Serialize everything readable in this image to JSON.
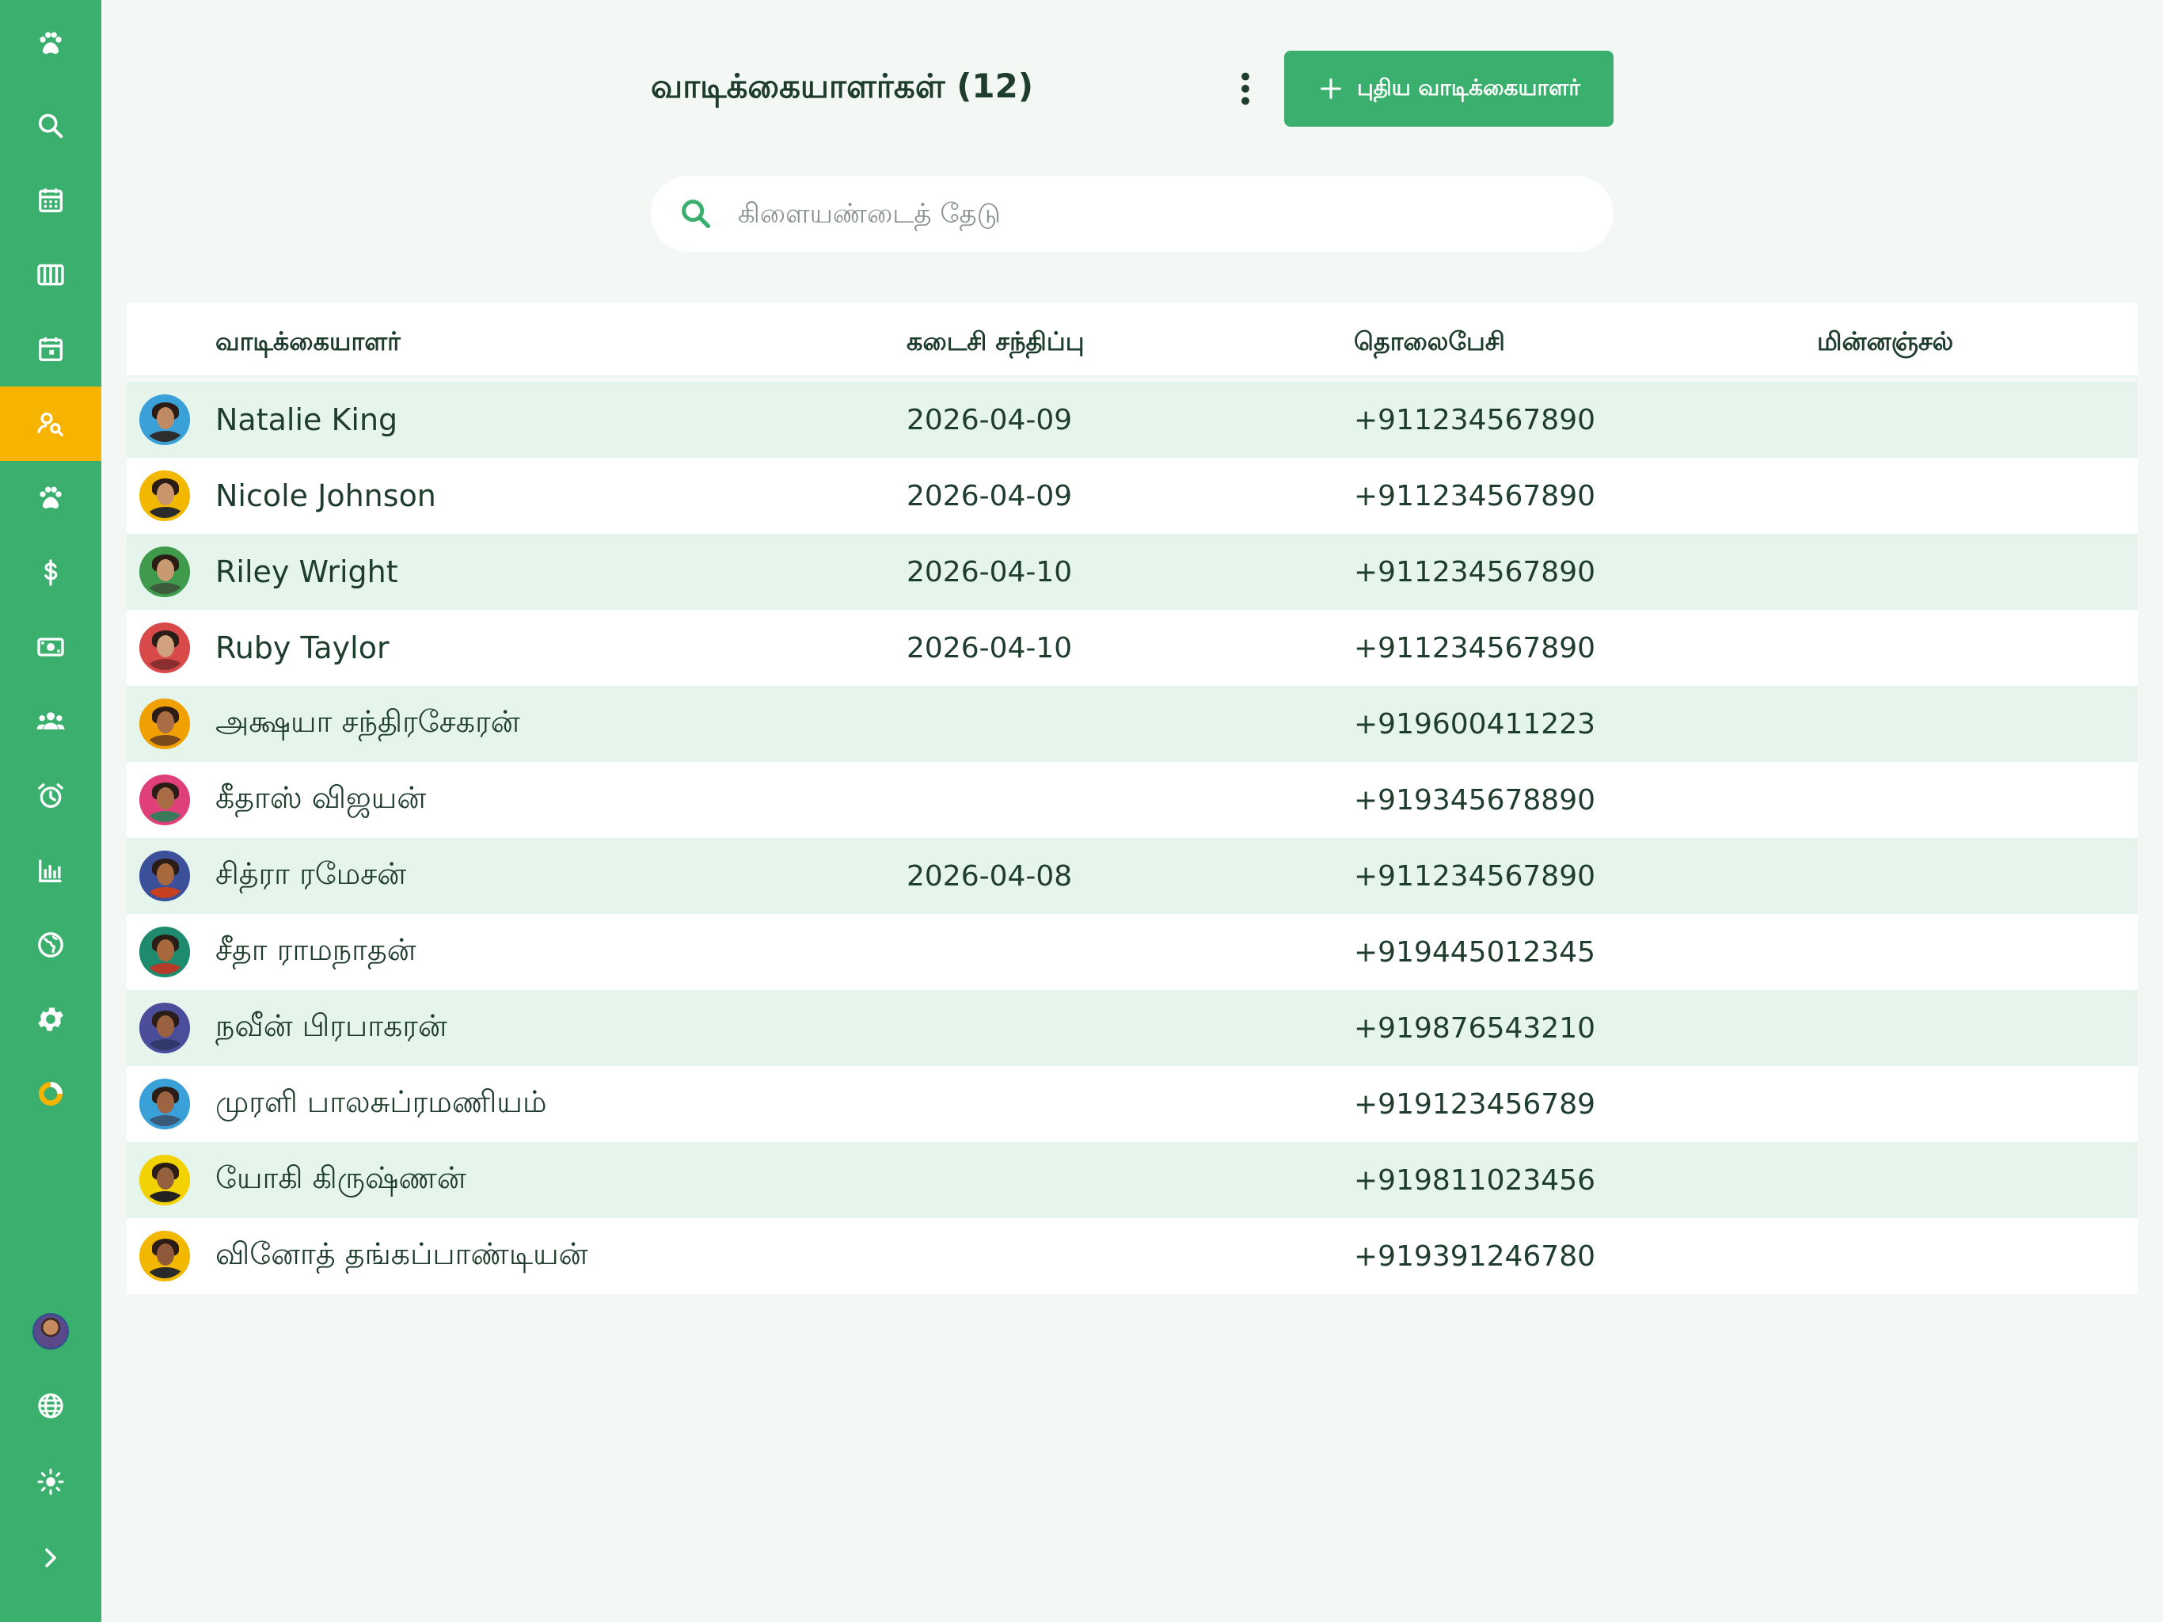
{
  "nav": {
    "items": [
      {
        "name": "paw-icon",
        "active": false
      },
      {
        "name": "search-icon",
        "active": false
      },
      {
        "name": "calendar-icon",
        "active": false
      },
      {
        "name": "columns-icon",
        "active": false
      },
      {
        "name": "calendar-event-icon",
        "active": false
      },
      {
        "name": "client-search-icon",
        "active": true
      },
      {
        "name": "paw-icon",
        "active": false
      },
      {
        "name": "dollar-icon",
        "active": false
      },
      {
        "name": "cash-icon",
        "active": false
      },
      {
        "name": "group-icon",
        "active": false
      },
      {
        "name": "alarm-icon",
        "active": false
      },
      {
        "name": "bar-chart-icon",
        "active": false
      },
      {
        "name": "globe-icon",
        "active": false
      },
      {
        "name": "gear-icon",
        "active": false
      },
      {
        "name": "donut-chart-icon",
        "active": false
      }
    ],
    "bottom": [
      "user-avatar",
      "globe-icon",
      "sun-icon",
      "chevron-right-icon"
    ]
  },
  "header": {
    "title": "வாடிக்கையாளர்கள் (12)",
    "add_label": "புதிய வாடிக்கையாளர்"
  },
  "search": {
    "placeholder": "கிளையண்டைத் தேடு"
  },
  "table": {
    "columns": [
      "வாடிக்கையாளர்",
      "கடைசி சந்திப்பு",
      "தொலைபேசி",
      "மின்னஞ்சல்"
    ],
    "rows": [
      {
        "name": "Natalie King",
        "last_visit": "2026-04-09",
        "phone": "+911234567890",
        "email": "",
        "ring": "#3aa0d8",
        "shirt": "#2d2d2d",
        "skin": "#c08a62"
      },
      {
        "name": "Nicole Johnson",
        "last_visit": "2026-04-09",
        "phone": "+911234567890",
        "email": "",
        "ring": "#f2b800",
        "shirt": "#2b2b2b",
        "skin": "#c9966c"
      },
      {
        "name": "Riley Wright",
        "last_visit": "2026-04-10",
        "phone": "+911234567890",
        "email": "",
        "ring": "#3f9a4c",
        "shirt": "#3c5a3c",
        "skin": "#c99a72"
      },
      {
        "name": "Ruby Taylor",
        "last_visit": "2026-04-10",
        "phone": "+911234567890",
        "email": "",
        "ring": "#d84a4a",
        "shirt": "#8a2f2f",
        "skin": "#d1a07c"
      },
      {
        "name": "அக்ஷயா சந்திரசேகரன்",
        "last_visit": "",
        "phone": "+919600411223",
        "email": "",
        "ring": "#f0a000",
        "shirt": "#7a4a1c",
        "skin": "#a86d44"
      },
      {
        "name": "கீதாஸ் விஜயன்",
        "last_visit": "",
        "phone": "+919345678890",
        "email": "",
        "ring": "#e0407a",
        "shirt": "#3a7a5a",
        "skin": "#a96d46"
      },
      {
        "name": "சித்ரா ரமேசன்",
        "last_visit": "2026-04-08",
        "phone": "+911234567890",
        "email": "",
        "ring": "#3b4f9a",
        "shirt": "#c4401e",
        "skin": "#a8693f"
      },
      {
        "name": "சீதா ராமநாதன்",
        "last_visit": "",
        "phone": "+919445012345",
        "email": "",
        "ring": "#1e8a6e",
        "shirt": "#b53a2a",
        "skin": "#a8693f"
      },
      {
        "name": "நவீன் பிரபாகரன்",
        "last_visit": "",
        "phone": "+919876543210",
        "email": "",
        "ring": "#4a4e9a",
        "shirt": "#2f3a6a",
        "skin": "#9a6240"
      },
      {
        "name": "முரளி பாலசுப்ரமணியம்",
        "last_visit": "",
        "phone": "+919123456789",
        "email": "",
        "ring": "#3aa0d8",
        "shirt": "#3a5a7a",
        "skin": "#9c6442"
      },
      {
        "name": "யோகி கிருஷ்ணன்",
        "last_visit": "",
        "phone": "+919811023456",
        "email": "",
        "ring": "#f2d200",
        "shirt": "#222222",
        "skin": "#94603e"
      },
      {
        "name": "வினோத் தங்கப்பாண்டியன்",
        "last_visit": "",
        "phone": "+919391246780",
        "email": "",
        "ring": "#f2b800",
        "shirt": "#2a2a2a",
        "skin": "#90593a"
      }
    ]
  },
  "colors": {
    "brand": "#3aaf6e",
    "active_nav": "#f6b300",
    "row_alt": "#e6f5ec",
    "text": "#1f3d2c"
  }
}
